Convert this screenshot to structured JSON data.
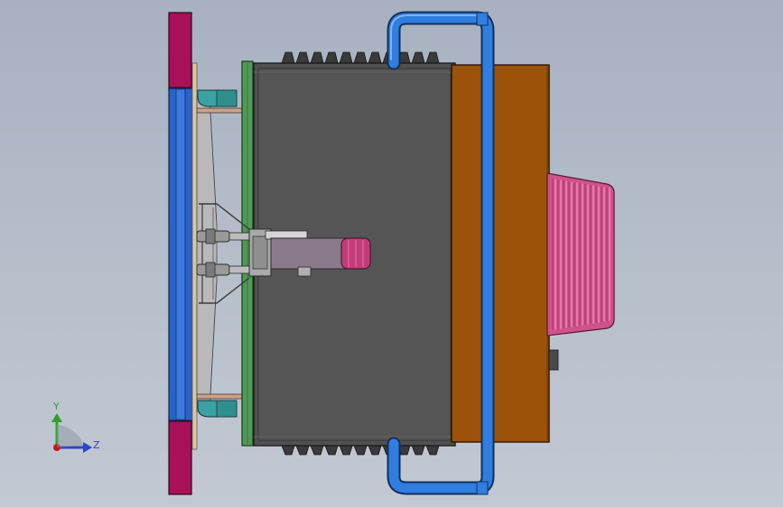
{
  "triad": {
    "y_label": "Y",
    "z_label": "Z"
  },
  "colors": {
    "background_top": "#a7b1c0",
    "background_bottom": "#c2c9d3",
    "magenta_plate": "#a8105a",
    "blue_panel": "#2a62c8",
    "green_board": "#4f9a55",
    "dark_body": "#505050",
    "orange_box": "#9c5208",
    "handle_blue": "#2f7ee0",
    "teal_bracket": "#3aa2a2",
    "pink_grill": "#d0518c",
    "axis_y": "#2ea22e",
    "axis_z": "#2b45c8",
    "axis_x": "#c01818"
  },
  "icons": {
    "triad": "coordinate-triad-icon"
  }
}
